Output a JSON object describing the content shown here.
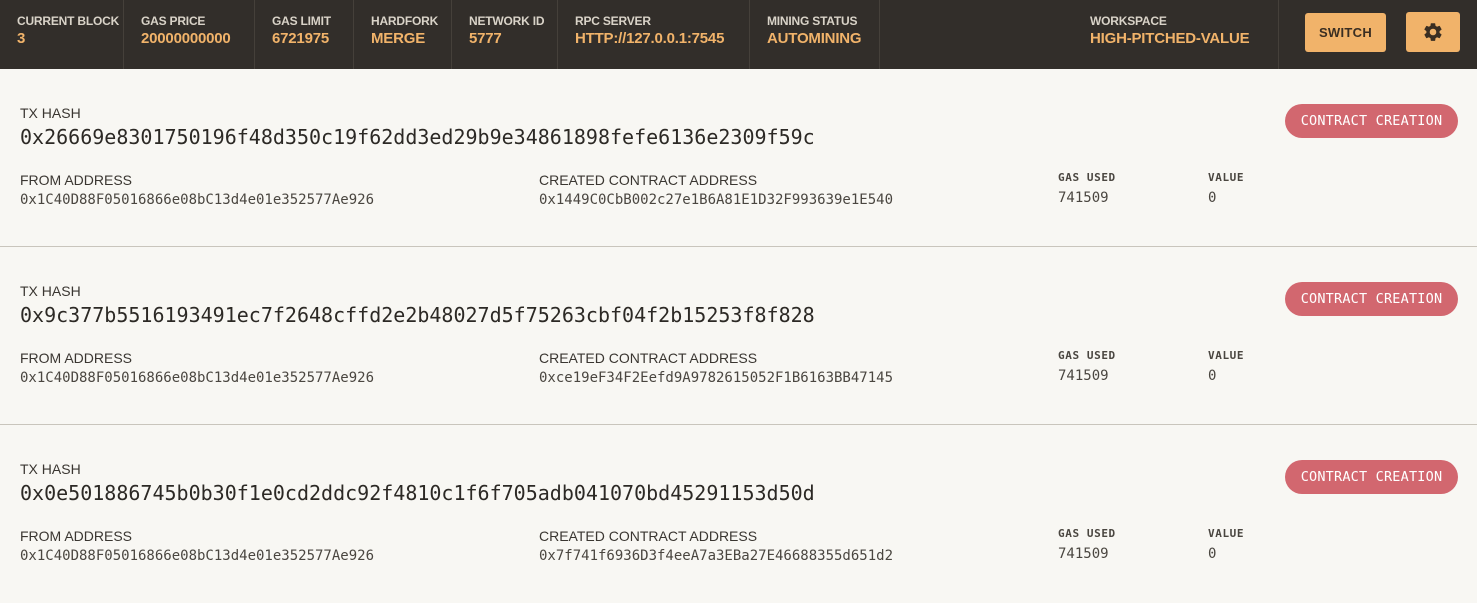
{
  "header": {
    "stats": [
      {
        "label": "CURRENT BLOCK",
        "value": "3"
      },
      {
        "label": "GAS PRICE",
        "value": "20000000000"
      },
      {
        "label": "GAS LIMIT",
        "value": "6721975"
      },
      {
        "label": "HARDFORK",
        "value": "MERGE"
      },
      {
        "label": "NETWORK ID",
        "value": "5777"
      },
      {
        "label": "RPC SERVER",
        "value": "HTTP://127.0.0.1:7545"
      },
      {
        "label": "MINING STATUS",
        "value": "AUTOMINING"
      }
    ],
    "workspace": {
      "label": "WORKSPACE",
      "value": "HIGH-PITCHED-VALUE"
    },
    "switch_label": "SWITCH",
    "settings_icon": "gear-icon"
  },
  "labels": {
    "tx_hash": "TX HASH",
    "from_address": "FROM ADDRESS",
    "created_contract_address": "CREATED CONTRACT ADDRESS",
    "gas_used": "GAS USED",
    "value": "VALUE"
  },
  "transactions": [
    {
      "hash": "0x26669e8301750196f48d350c19f62dd3ed29b9e34861898fefe6136e2309f59c",
      "badge": "CONTRACT CREATION",
      "from": "0x1C40D88F05016866e08bC13d4e01e352577Ae926",
      "created": "0x1449C0CbB002c27e1B6A81E1D32F993639e1E540",
      "gas_used": "741509",
      "value": "0"
    },
    {
      "hash": "0x9c377b5516193491ec7f2648cffd2e2b48027d5f75263cbf04f2b15253f8f828",
      "badge": "CONTRACT CREATION",
      "from": "0x1C40D88F05016866e08bC13d4e01e352577Ae926",
      "created": "0xce19eF34F2Eefd9A9782615052F1B6163BB47145",
      "gas_used": "741509",
      "value": "0"
    },
    {
      "hash": "0x0e501886745b0b30f1e0cd2ddc92f4810c1f6f705adb041070bd45291153d50d",
      "badge": "CONTRACT CREATION",
      "from": "0x1C40D88F05016866e08bC13d4e01e352577Ae926",
      "created": "0x7f741f6936D3f4eeA7a3EBa27E46688355d651d2",
      "gas_used": "741509",
      "value": "0"
    }
  ],
  "colors": {
    "topbar_bg": "#322e2a",
    "accent": "#f1b36a",
    "badge_bg": "#d2676f",
    "page_bg": "#f8f7f3"
  }
}
